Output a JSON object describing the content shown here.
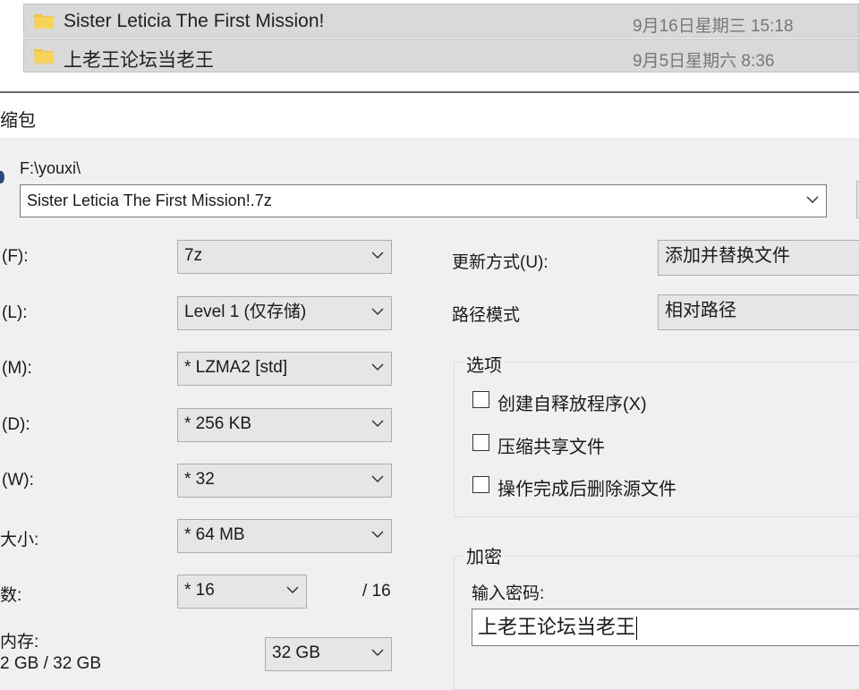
{
  "file_list": [
    {
      "name": "Sister Leticia The First Mission!",
      "date": "9月16日星期三 15:18"
    },
    {
      "name": "上老王论坛当老王",
      "date": "9月5日星期六 8:36"
    }
  ],
  "dialog": {
    "title": "缩包",
    "path_label": "F:\\youxi\\",
    "archive_name": "Sister Leticia The First Mission!.7z",
    "fields": {
      "format_label": "(F):",
      "format_value": "7z",
      "level_label": "(L):",
      "level_value": "Level 1 (仅存储)",
      "method_label": "(M):",
      "method_value": "* LZMA2 [std]",
      "dict_label": "(D):",
      "dict_value": "* 256 KB",
      "word_label": "(W):",
      "word_value": "* 32",
      "solid_label": "大小:",
      "solid_value": "* 64 MB",
      "threads_label": "数:",
      "threads_value": "* 16",
      "threads_max": "/ 16",
      "memory_label": "内存:",
      "memory_usage": "2 GB / 32 GB",
      "memory_value": "32 GB"
    },
    "update_mode_label": "更新方式(U):",
    "update_mode_value": "添加并替换文件",
    "path_mode_label": "路径模式",
    "path_mode_value": "相对路径",
    "options": {
      "title": "选项",
      "items": [
        {
          "label": "创建自释放程序(X)",
          "checked": false
        },
        {
          "label": "压缩共享文件",
          "checked": false
        },
        {
          "label": "操作完成后删除源文件",
          "checked": false
        }
      ]
    },
    "encryption": {
      "title": "加密",
      "password_label": "输入密码:",
      "password_value": "上老王论坛当老王"
    }
  },
  "icons": {
    "folder": "folder-icon",
    "dropdown": "chevron-down-icon"
  },
  "colors": {
    "folder": "#f4c542",
    "selection": "#d9d9d9",
    "dialog_bg": "#f0f0f0"
  }
}
